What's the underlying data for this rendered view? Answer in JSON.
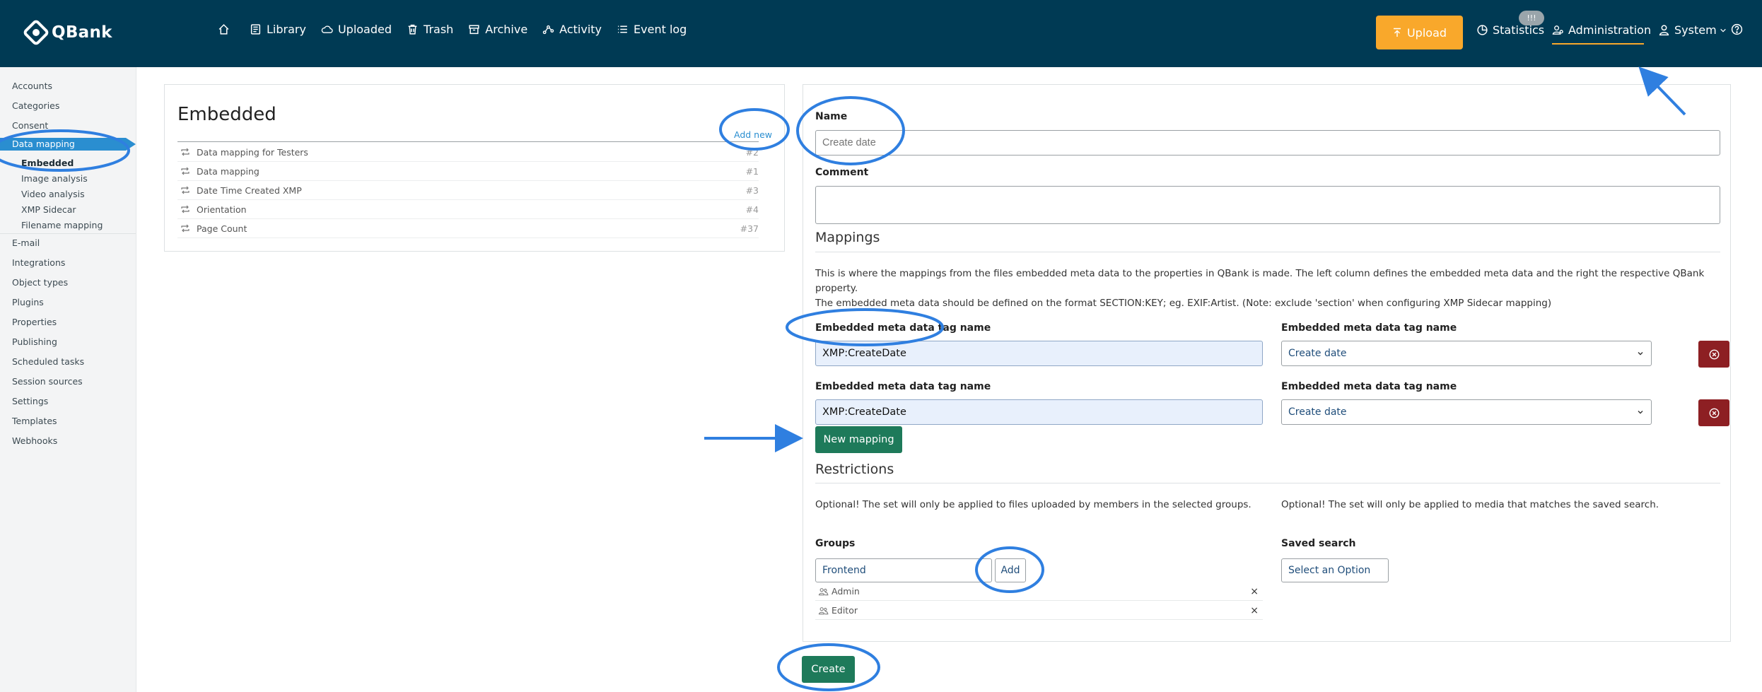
{
  "brand": {
    "name": "QBank"
  },
  "nav": {
    "home_icon": "home-icon",
    "items": [
      {
        "label": "Library",
        "icon": "library-icon"
      },
      {
        "label": "Uploaded",
        "icon": "cloud-icon"
      },
      {
        "label": "Trash",
        "icon": "trash-icon"
      },
      {
        "label": "Archive",
        "icon": "archive-icon"
      },
      {
        "label": "Activity",
        "icon": "activity-icon"
      },
      {
        "label": "Event log",
        "icon": "list-icon"
      }
    ]
  },
  "header": {
    "upload_label": "Upload",
    "statistics_label": "Statistics",
    "statistics_badge": "!!!",
    "administration_label": "Administration",
    "system_label": "System"
  },
  "sidebar": {
    "items": [
      "Accounts",
      "Categories",
      "Consent",
      "Data mapping"
    ],
    "subitems": [
      "Embedded",
      "Image analysis",
      "Video analysis",
      "XMP Sidecar",
      "Filename mapping"
    ],
    "items_after": [
      "E-mail",
      "Integrations",
      "Object types",
      "Plugins",
      "Properties",
      "Publishing",
      "Scheduled tasks",
      "Session sources",
      "Settings",
      "Templates",
      "Webhooks"
    ]
  },
  "list": {
    "title": "Embedded",
    "add_new": "Add new",
    "rows": [
      {
        "name": "Data mapping for Testers",
        "num": "#2"
      },
      {
        "name": "Data mapping",
        "num": "#1"
      },
      {
        "name": "Date Time Created XMP",
        "num": "#3"
      },
      {
        "name": "Orientation",
        "num": "#4"
      },
      {
        "name": "Page Count",
        "num": "#37"
      }
    ]
  },
  "form": {
    "name_label": "Name",
    "name_placeholder": "Create date",
    "comment_label": "Comment",
    "mappings_title": "Mappings",
    "mappings_text": "This is where the mappings from the files embedded meta data to the properties in QBank is made. The left column defines the embedded meta data and the right the respective QBank property.",
    "mappings_text2": "The embedded meta data should be defined on the format SECTION:KEY; eg. EXIF:Artist. (Note: exclude 'section' when configuring XMP Sidecar mapping)",
    "mapping_rows": [
      {
        "left_label": "Embedded meta data tag name",
        "left_value": "XMP:CreateDate",
        "right_label": "Embedded meta data tag name",
        "right_value": "Create date"
      },
      {
        "left_label": "Embedded meta data tag name",
        "left_value": "XMP:CreateDate",
        "right_label": "Embedded meta data tag name",
        "right_value": "Create date"
      }
    ],
    "new_mapping": "New mapping",
    "restrictions_title": "Restrictions",
    "restrictions_left": "Optional! The set will only be applied to files uploaded by members in the selected groups.",
    "restrictions_right": "Optional! The set will only be applied to media that matches the saved search.",
    "groups_label": "Groups",
    "groups_value": "Frontend",
    "add_label": "Add",
    "groups": [
      "Admin",
      "Editor"
    ],
    "saved_search_label": "Saved search",
    "saved_search_value": "Select an Option",
    "create_label": "Create"
  },
  "colors": {
    "topbar": "#003a54",
    "accent": "#f9a82b",
    "primary": "#1e7a5a",
    "danger": "#8d1f23",
    "link": "#2a8ed0",
    "annotation": "#2f7fe0"
  }
}
